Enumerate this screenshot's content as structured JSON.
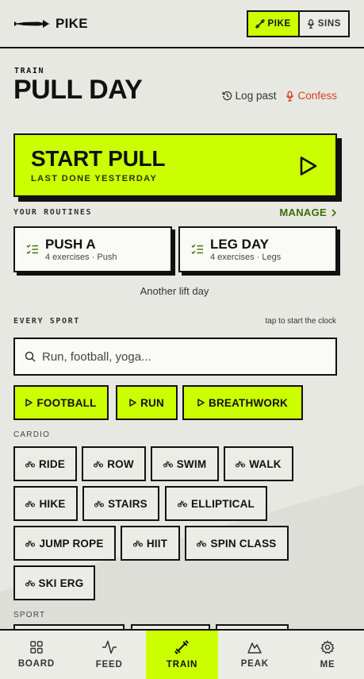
{
  "header": {
    "brand": "PIKE",
    "brand_icon": "pike-fish-icon",
    "toggle": [
      {
        "label": "PIKE",
        "icon": "dumbbell-icon",
        "active": true
      },
      {
        "label": "SINS",
        "icon": "microphone-icon",
        "active": false
      }
    ]
  },
  "page": {
    "eyebrow": "TRAIN",
    "title": "PULL DAY",
    "actions": {
      "log_past": "Log past",
      "confess": "Confess"
    }
  },
  "start": {
    "title": "START PULL",
    "subtitle": "LAST DONE YESTERDAY"
  },
  "routines": {
    "label": "YOUR ROUTINES",
    "manage": "MANAGE",
    "items": [
      {
        "name": "PUSH A",
        "meta": "4 exercises · Push"
      },
      {
        "name": "LEG DAY",
        "meta": "4 exercises · Legs"
      }
    ],
    "note": "Another lift day"
  },
  "sports": {
    "label": "EVERY SPORT",
    "hint": "tap to start the clock",
    "search_placeholder": "Run, football, yoga...",
    "favorites": [
      "FOOTBALL",
      "RUN",
      "BREATHWORK"
    ],
    "cardio_label": "CARDIO",
    "cardio": [
      "RIDE",
      "ROW",
      "SWIM",
      "WALK",
      "HIKE",
      "STAIRS",
      "ELLIPTICAL",
      "JUMP ROPE",
      "HIIT",
      "SPIN CLASS",
      "SKI ERG"
    ],
    "sport_label": "SPORT"
  },
  "nav": [
    {
      "label": "BOARD",
      "icon": "grid-icon",
      "active": false
    },
    {
      "label": "FEED",
      "icon": "activity-icon",
      "active": false
    },
    {
      "label": "TRAIN",
      "icon": "dumbbell-icon",
      "active": true
    },
    {
      "label": "PEAK",
      "icon": "mountain-icon",
      "active": false
    },
    {
      "label": "ME",
      "icon": "gear-icon",
      "active": false
    }
  ],
  "colors": {
    "accent": "#ccff00",
    "confess": "#d6401f",
    "manage": "#3c6d05",
    "background": "#e8e8e2"
  }
}
